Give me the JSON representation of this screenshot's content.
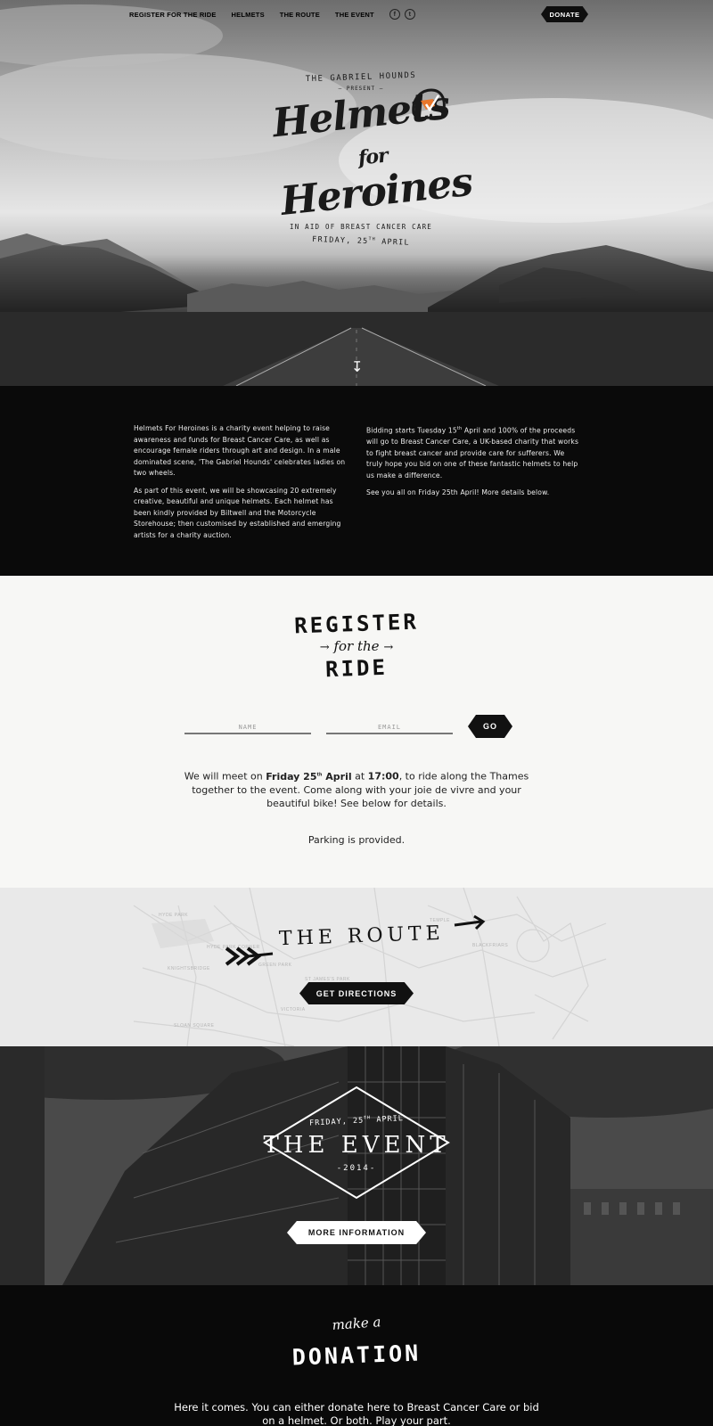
{
  "nav": {
    "items": [
      "REGISTER FOR THE RIDE",
      "HELMETS",
      "THE ROUTE",
      "THE EVENT"
    ],
    "social": [
      {
        "icon": "facebook-icon",
        "glyph": "f"
      },
      {
        "icon": "twitter-icon",
        "glyph": "t"
      }
    ],
    "donate_label": "DONATE"
  },
  "hero": {
    "presenter": "THE GABRIEL HOUNDS",
    "present": "— PRESENT —",
    "title_line1": "Helmets",
    "title_for": "for",
    "title_line2": "Heroines",
    "aid": "IN AID OF BREAST CANCER CARE",
    "date_prefix": "FRIDAY, 25",
    "date_sup": "TH",
    "date_suffix": " APRIL",
    "scroll_icon": "down-arrow-icon"
  },
  "intro": {
    "left": [
      "Helmets For Heroines is a charity event helping to raise awareness and funds for Breast Cancer Care, as well as encourage female riders through art and design. In a male dominated scene, 'The Gabriel Hounds' celebrates ladies on two wheels.",
      "As part of this event, we will be showcasing 20 extremely creative, beautiful and unique helmets. Each helmet has been kindly provided by Biltwell and the Motorcycle Storehouse; then customised by established and emerging artists for a charity auction."
    ],
    "right1_pre": "Bidding starts Tuesday 15",
    "right1_sup": "th",
    "right1_post": " April and 100% of the proceeds will go to Breast Cancer Care, a UK-based charity that works to fight breast cancer and provide care for sufferers.  We truly hope you bid on one of these fantastic helmets to help us make a difference.",
    "right2": "See you all on Friday 25th April! More details below."
  },
  "register": {
    "title_top": "REGISTER",
    "title_mid": "for the",
    "title_bottom": "RIDE",
    "name_placeholder": "NAME",
    "email_placeholder": "EMAIL",
    "go_label": "GO",
    "text_a": "We will meet on ",
    "text_b": "Friday 25",
    "text_b_sup": "th",
    "text_c": " April",
    "text_d": " at ",
    "text_e": "17:00",
    "text_f": ", to ride along the Thames together to the event. Come along with your joie de vivre and your beautiful bike! See below for details.",
    "parking": "Parking is provided."
  },
  "route": {
    "title": "THE ROUTE",
    "button_label": "GET DIRECTIONS",
    "map_labels": [
      "HYDE PARK",
      "HYDE PARK CORNER",
      "KNIGHTSBRIDGE",
      "GREEN PARK",
      "ST JAMES'S PARK",
      "VICTORIA",
      "SLOAN SQUARE",
      "TEMPLE",
      "BLACKFRIARS"
    ]
  },
  "event": {
    "date_prefix": "FRIDAY, 25",
    "date_sup": "TH",
    "date_suffix": " APRIL",
    "title": "THE EVENT",
    "year": "-2014-",
    "button_label": "MORE INFORMATION"
  },
  "donation": {
    "script": "make a",
    "title": "DONATION",
    "text": "Here it comes. You can either donate here to Breast Cancer Care or bid on a helmet. Or both. Play your part."
  },
  "colors": {
    "accent": "#e8762a",
    "dark": "#0a0a0a",
    "light": "#f7f7f5"
  }
}
